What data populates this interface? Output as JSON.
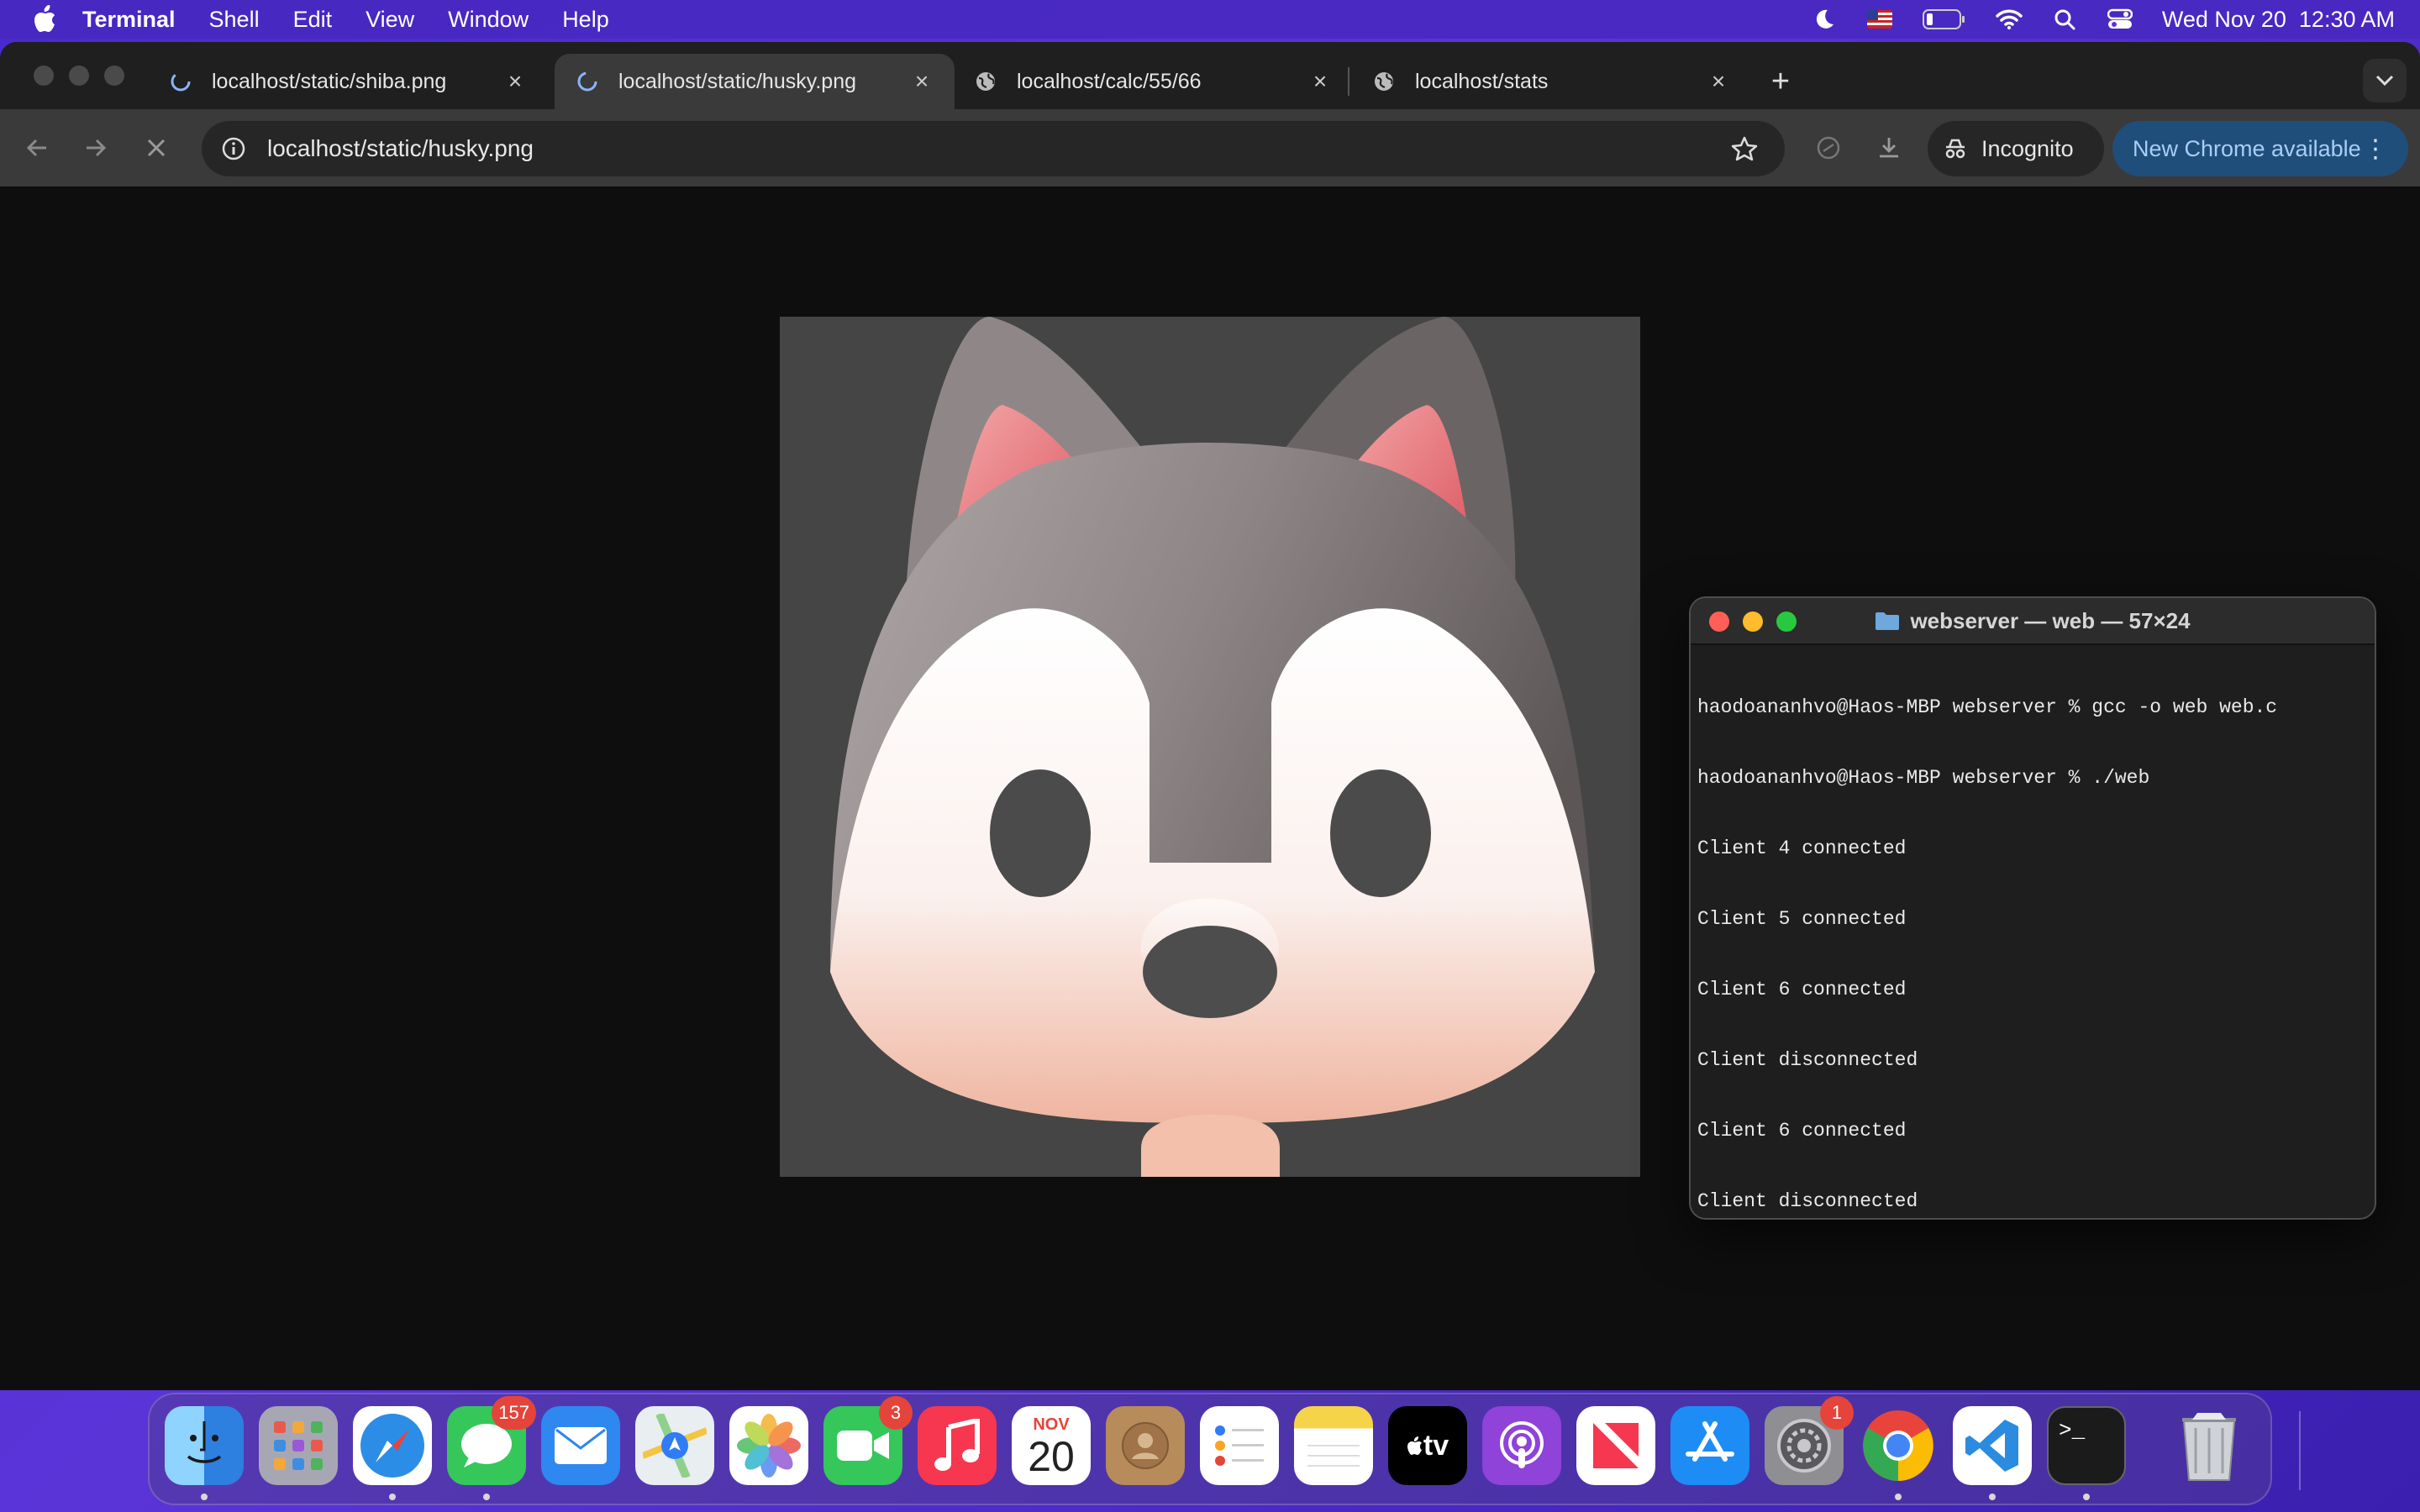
{
  "menubar": {
    "app_name": "Terminal",
    "menus": [
      "Shell",
      "Edit",
      "View",
      "Window",
      "Help"
    ],
    "clock": "Wed Nov 20  12:30 AM"
  },
  "browser": {
    "tabs": [
      {
        "title": "localhost/static/shiba.png",
        "favicon": "loading-icon",
        "active": false
      },
      {
        "title": "localhost/static/husky.png",
        "favicon": "loading-icon",
        "active": true
      },
      {
        "title": "localhost/calc/55/66",
        "favicon": "globe-icon",
        "active": false
      },
      {
        "title": "localhost/stats",
        "favicon": "globe-icon",
        "active": false
      }
    ],
    "url": "localhost/static/husky.png",
    "incognito_label": "Incognito",
    "update_label": "New Chrome available"
  },
  "terminal": {
    "title": "webserver — web — 57×24",
    "lines": [
      "haodoananhvo@Haos-MBP webserver % gcc -o web web.c",
      "haodoananhvo@Haos-MBP webserver % ./web",
      "Client 4 connected",
      "Client 5 connected",
      "Client 6 connected",
      "Client disconnected",
      "Client 6 connected",
      "Client disconnected"
    ]
  },
  "dock": {
    "apps": [
      {
        "name": "Finder",
        "icon": "finder-icon",
        "badge": "",
        "running": true
      },
      {
        "name": "Launchpad",
        "icon": "launchpad-icon",
        "badge": "",
        "running": false
      },
      {
        "name": "Safari",
        "icon": "safari-icon",
        "badge": "",
        "running": true
      },
      {
        "name": "Messages",
        "icon": "messages-icon",
        "badge": "157",
        "running": true
      },
      {
        "name": "Mail",
        "icon": "mail-icon",
        "badge": "",
        "running": false
      },
      {
        "name": "Maps",
        "icon": "maps-icon",
        "badge": "",
        "running": false
      },
      {
        "name": "Photos",
        "icon": "photos-icon",
        "badge": "",
        "running": false
      },
      {
        "name": "FaceTime",
        "icon": "facetime-icon",
        "badge": "3",
        "running": false
      },
      {
        "name": "Music",
        "icon": "music-icon",
        "badge": "",
        "running": false
      },
      {
        "name": "Calendar",
        "icon": "calendar-icon",
        "badge": "",
        "running": false,
        "month": "NOV",
        "day": "20"
      },
      {
        "name": "Contacts",
        "icon": "contacts-icon",
        "badge": "",
        "running": false
      },
      {
        "name": "Reminders",
        "icon": "reminders-icon",
        "badge": "",
        "running": false
      },
      {
        "name": "Notes",
        "icon": "notes-icon",
        "badge": "",
        "running": false
      },
      {
        "name": "TV",
        "icon": "tv-icon",
        "badge": "",
        "running": false,
        "label": "tv"
      },
      {
        "name": "Podcasts",
        "icon": "podcasts-icon",
        "badge": "",
        "running": false
      },
      {
        "name": "News",
        "icon": "news-icon",
        "badge": "",
        "running": false
      },
      {
        "name": "App Store",
        "icon": "app-store-icon",
        "badge": "",
        "running": false
      },
      {
        "name": "System Settings",
        "icon": "settings-icon",
        "badge": "1",
        "running": false
      },
      {
        "name": "Chrome",
        "icon": "chrome-icon",
        "badge": "",
        "running": true
      },
      {
        "name": "VS Code",
        "icon": "vscode-icon",
        "badge": "",
        "running": true
      },
      {
        "name": "Terminal",
        "icon": "terminal-icon",
        "badge": "",
        "running": true,
        "label": ">_"
      },
      {
        "name": "Trash",
        "icon": "trash-icon",
        "badge": "",
        "running": false
      }
    ]
  },
  "colors": {
    "desktop": "#4a2ad0",
    "chrome_tab_active": "#3a3a3a",
    "update_pill": "#1f4e7a",
    "close_red": "#ff5f57",
    "min_yellow": "#febc2e",
    "max_green": "#28c840",
    "badge_red": "#e5443b"
  }
}
